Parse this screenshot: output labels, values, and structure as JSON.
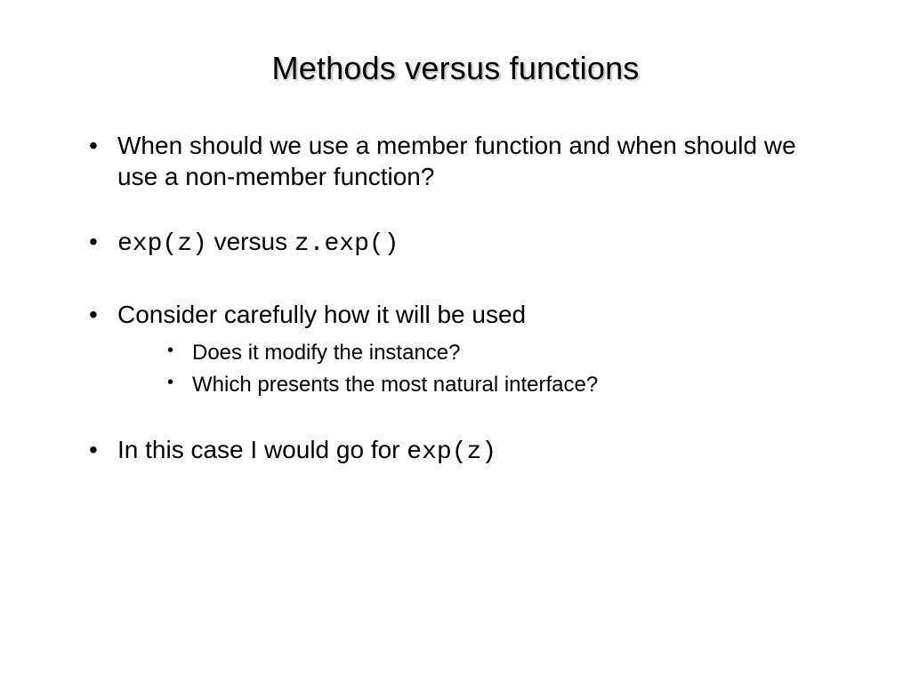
{
  "title": "Methods versus functions",
  "b1": "When should we use a member function and when should we use a non-member function?",
  "b2_code1": "exp(z)",
  "b2_mid": " versus ",
  "b2_code2": "z.exp()",
  "b3": "Consider carefully how it will be used",
  "b3s1": "Does it modify the instance?",
  "b3s2": "Which presents the most natural interface?",
  "b4_pre": "In this case I would go for ",
  "b4_code": "exp(z)"
}
